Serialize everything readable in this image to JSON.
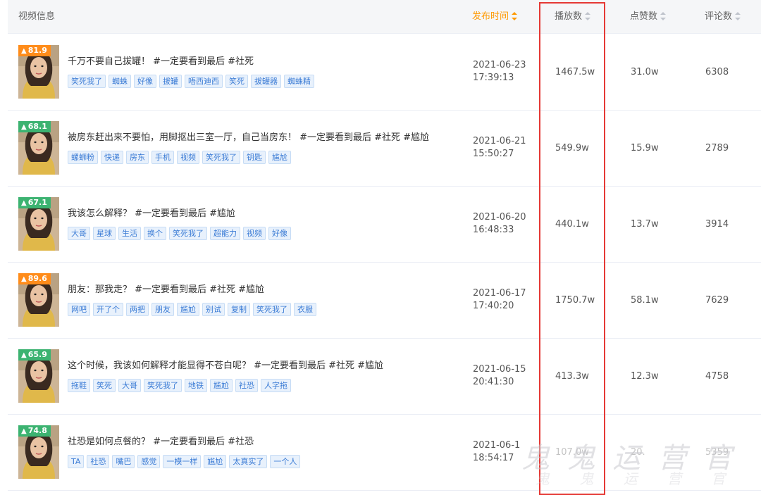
{
  "header": {
    "video_info": "视频信息",
    "publish_time": "发布时间",
    "plays": "播放数",
    "likes": "点赞数",
    "comments": "评论数"
  },
  "accent_color": "#ff9900",
  "highlight_color": "#e53935",
  "rows": [
    {
      "score": "81.9",
      "badge_color": "orange",
      "title": "千万不要自己拔罐！ #一定要看到最后 #社死",
      "tags": [
        "笑死我了",
        "蜘蛛",
        "好像",
        "拔罐",
        "唔西迪西",
        "笑死",
        "拔罐器",
        "蜘蛛精"
      ],
      "date": "2021-06-23",
      "time": "17:39:13",
      "plays": "1467.5w",
      "likes": "31.0w",
      "comments": "6308"
    },
    {
      "score": "68.1",
      "badge_color": "green",
      "title": "被房东赶出来不要怕，用脚抠出三室一厅，自己当房东！ #一定要看到最后 #社死 #尴尬",
      "tags": [
        "螺蛳粉",
        "快递",
        "房东",
        "手机",
        "视频",
        "笑死我了",
        "钥匙",
        "尴尬"
      ],
      "date": "2021-06-21",
      "time": "15:50:27",
      "plays": "549.9w",
      "likes": "15.9w",
      "comments": "2789"
    },
    {
      "score": "67.1",
      "badge_color": "green",
      "title": "我该怎么解释？ #一定要看到最后 #尴尬",
      "tags": [
        "大哥",
        "星球",
        "生活",
        "换个",
        "笑死我了",
        "超能力",
        "视频",
        "好像"
      ],
      "date": "2021-06-20",
      "time": "16:48:33",
      "plays": "440.1w",
      "likes": "13.7w",
      "comments": "3914"
    },
    {
      "score": "89.6",
      "badge_color": "orange",
      "title": "朋友：那我走？ #一定要看到最后 #社死 #尴尬",
      "tags": [
        "网吧",
        "开了个",
        "两把",
        "朋友",
        "尴尬",
        "别试",
        "复制",
        "笑死我了",
        "衣服"
      ],
      "date": "2021-06-17",
      "time": "17:40:20",
      "plays": "1750.7w",
      "likes": "58.1w",
      "comments": "7629"
    },
    {
      "score": "65.9",
      "badge_color": "green",
      "title": "这个时候，我该如何解释才能显得不苍白呢？ #一定要看到最后 #社死 #尴尬",
      "tags": [
        "拖鞋",
        "笑死",
        "大哥",
        "笑死我了",
        "地铁",
        "尴尬",
        "社恐",
        "人字拖"
      ],
      "date": "2021-06-15",
      "time": "20:41:30",
      "plays": "413.3w",
      "likes": "12.3w",
      "comments": "4758"
    },
    {
      "score": "74.8",
      "badge_color": "green",
      "title": "社恐是如何点餐的？ #一定要看到最后 #社恐",
      "tags": [
        "TA",
        "社恐",
        "嘴巴",
        "感觉",
        "一模一样",
        "尴尬",
        "太真实了",
        "一个人"
      ],
      "date": "2021-06-1",
      "time": "18:54:17",
      "plays": "107.0w",
      "likes": "20.",
      "comments": "5359"
    }
  ],
  "watermark": "鬼 鬼 运 营 官",
  "watermark_sub": "鬼 鬼 运 营 官"
}
